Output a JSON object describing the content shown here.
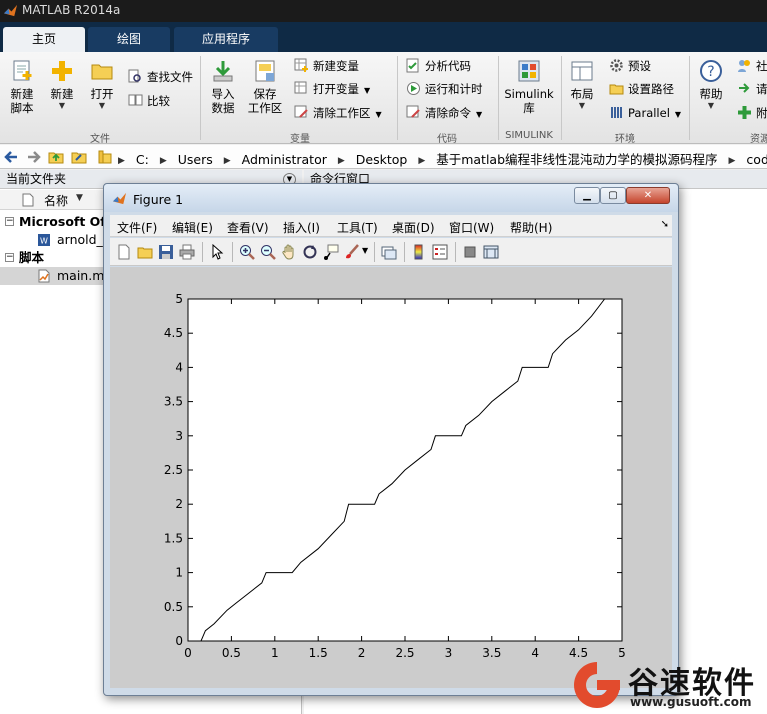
{
  "app": {
    "title": "MATLAB R2014a"
  },
  "tabs": [
    {
      "label": "主页",
      "active": true
    },
    {
      "label": "绘图",
      "active": false
    },
    {
      "label": "应用程序",
      "active": false
    }
  ],
  "ribbon": {
    "file": {
      "new_script": "新建\n脚本",
      "new": "新建",
      "open": "打开",
      "find_files": "查找文件",
      "compare": "比较",
      "group": "文件"
    },
    "variable": {
      "import": "导入\n数据",
      "save_workspace": "保存\n工作区",
      "new_variable": "新建变量",
      "open_variable": "打开变量",
      "clear_workspace": "清除工作区",
      "group": "变量"
    },
    "code": {
      "analyze": "分析代码",
      "run_time": "运行和计时",
      "clear_commands": "清除命令",
      "group": "代码"
    },
    "simulink": {
      "library": "Simulink\n库",
      "group": "SIMULINK"
    },
    "environment": {
      "layout": "布局",
      "preferences": "预设",
      "set_path": "设置路径",
      "parallel": "Parallel",
      "group": "环境"
    },
    "resources": {
      "help": "帮助",
      "community": "社",
      "request": "请",
      "addons": "附",
      "group": "资源"
    }
  },
  "address": {
    "crumbs": [
      "C:",
      "Users",
      "Administrator",
      "Desktop",
      "基于matlab编程非线性混沌动力学的模拟源码程序",
      "code"
    ]
  },
  "left_panel": {
    "title": "当前文件夹",
    "column": "名称",
    "items": [
      {
        "label": "Microsoft Off",
        "kind": "group"
      },
      {
        "label": "arnold_t",
        "kind": "file"
      },
      {
        "label": "脚本",
        "kind": "group"
      },
      {
        "label": "main.m",
        "kind": "file",
        "selected": true
      }
    ]
  },
  "right_panel": {
    "title": "命令行窗口"
  },
  "figure": {
    "title": "Figure 1",
    "menus": [
      "文件(F)",
      "编辑(E)",
      "查看(V)",
      "插入(I)",
      "工具(T)",
      "桌面(D)",
      "窗口(W)",
      "帮助(H)"
    ],
    "toolbar_icons": [
      "new-figure-icon",
      "open-file-icon",
      "save-icon",
      "print-icon",
      "pointer-icon",
      "zoom-in-icon",
      "zoom-out-icon",
      "pan-icon",
      "rotate-icon",
      "data-cursor-icon",
      "brush-icon",
      "link-icon",
      "colorbar-icon",
      "legend-icon",
      "hide-plot-tools-icon",
      "show-plot-tools-icon"
    ]
  },
  "chart_data": {
    "type": "line",
    "title": "",
    "xlabel": "",
    "ylabel": "",
    "xlim": [
      0,
      5
    ],
    "ylim": [
      0,
      5
    ],
    "xticks": [
      "0",
      "0.5",
      "1",
      "1.5",
      "2",
      "2.5",
      "3",
      "3.5",
      "4",
      "4.5",
      "5"
    ],
    "yticks": [
      "0",
      "0.5",
      "1",
      "1.5",
      "2",
      "2.5",
      "3",
      "3.5",
      "4",
      "4.5",
      "5"
    ],
    "grid": false,
    "series": [
      {
        "color": "#000000",
        "x": [
          0,
          0.15,
          0.2,
          0.3,
          0.45,
          0.55,
          0.7,
          0.85,
          0.9,
          1.2,
          1.3,
          1.5,
          1.65,
          1.8,
          1.85,
          2.15,
          2.2,
          2.35,
          2.5,
          2.65,
          2.8,
          2.85,
          3.15,
          3.2,
          3.35,
          3.5,
          3.65,
          3.8,
          3.85,
          4.15,
          4.2,
          4.35,
          4.5,
          4.65,
          4.8
        ],
        "y": [
          0,
          0,
          0.15,
          0.25,
          0.45,
          0.55,
          0.7,
          0.85,
          1.0,
          1.0,
          1.15,
          1.35,
          1.55,
          1.75,
          2.0,
          2.0,
          2.15,
          2.3,
          2.5,
          2.65,
          2.8,
          3.0,
          3.0,
          3.15,
          3.3,
          3.5,
          3.65,
          3.8,
          4.0,
          4.0,
          4.2,
          4.4,
          4.55,
          4.75,
          5.0
        ]
      }
    ]
  },
  "watermark": {
    "text": "谷速软件",
    "url": "www.gusuoft.com"
  },
  "colors": {
    "titlebar": "#1b1b1b",
    "tabbar": "#0f2a45",
    "accent": "#e24b2d"
  }
}
